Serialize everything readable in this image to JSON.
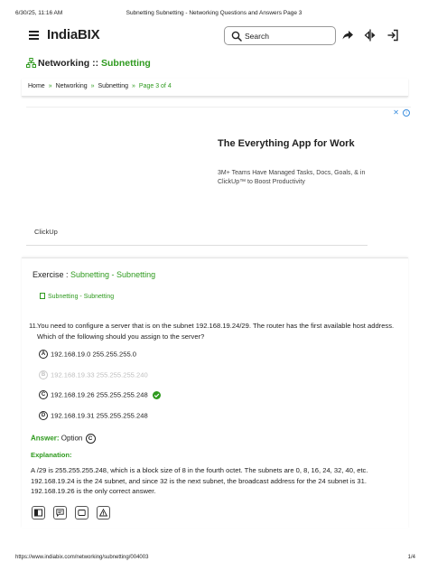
{
  "print_header": {
    "datetime": "6/30/25, 11:16 AM",
    "title": "Subnetting Subnetting - Networking Questions and Answers Page 3"
  },
  "topbar": {
    "logo": "IndiaBIX",
    "search_placeholder": "Search"
  },
  "page_title": {
    "category": "Networking",
    "separator": " :: ",
    "topic": "Subnetting"
  },
  "breadcrumb": [
    "Home",
    "Networking",
    "Subnetting",
    "Page 3 of 4"
  ],
  "ad": {
    "headline": "The Everything App for Work",
    "body": "3M+ Teams Have Managed Tasks, Docs, Goals, & in ClickUp™ to Boost Productivity",
    "brand": "ClickUp"
  },
  "exercise": {
    "label": "Exercise : ",
    "topic": "Subnetting - Subnetting",
    "topic_link": "Subnetting - Subnetting"
  },
  "question": {
    "number": "11.",
    "text": "You need to configure a server that is on the subnet 192.168.19.24/29. The router has the first available host address. Which of the following should you assign to the server?",
    "options": [
      {
        "letter": "A",
        "text": "192.168.19.0 255.255.255.0"
      },
      {
        "letter": "B",
        "text": "192.168.19.33 255.255.255.240"
      },
      {
        "letter": "C",
        "text": "192.168.19.26 255.255.255.248"
      },
      {
        "letter": "D",
        "text": "192.168.19.31 255.255.255.248"
      }
    ]
  },
  "answer": {
    "label": "Answer:",
    "prefix": " Option ",
    "letter": "C"
  },
  "explanation": {
    "label": "Explanation:",
    "text": "A /29 is 255.255.255.248, which is a block size of 8 in the fourth octet. The subnets are 0, 8, 16, 24, 32, 40, etc. 192.168.19.24 is the 24 subnet, and since 32 is the next subnet, the broadcast address for the 24 subnet is 31. 192.168.19.26 is the only correct answer."
  },
  "print_footer": {
    "url": "https://www.indiabix.com/networking/subnetting/004003",
    "page": "1/4"
  },
  "colors": {
    "accent_green": "#2e9a1e",
    "text": "#222222"
  },
  "icons": [
    "menu-icon",
    "search-icon",
    "share-icon",
    "compare-icon",
    "login-icon",
    "network-icon",
    "check-icon",
    "workspace-icon",
    "discuss-icon",
    "report-icon",
    "warning-icon"
  ]
}
